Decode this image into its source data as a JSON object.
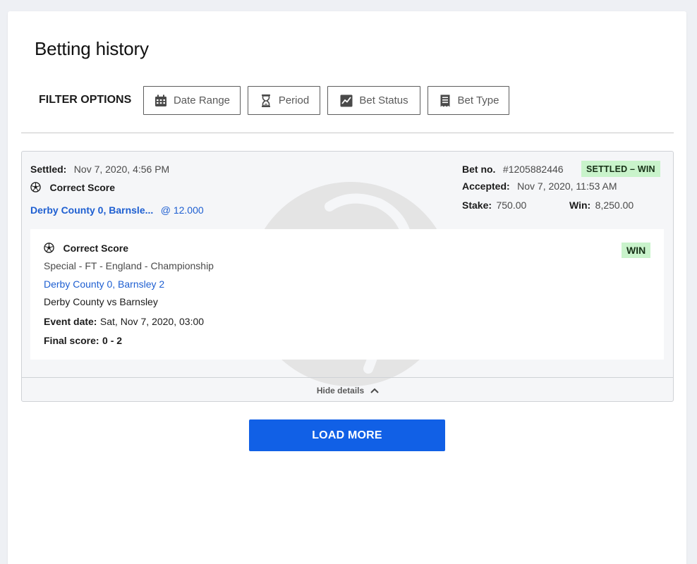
{
  "page": {
    "title": "Betting history"
  },
  "filters": {
    "label": "FILTER OPTIONS",
    "buttons": [
      {
        "label": "Date Range",
        "icon": "calendar-icon"
      },
      {
        "label": "Period",
        "icon": "hourglass-icon"
      },
      {
        "label": "Bet Status",
        "icon": "chart-line-icon"
      },
      {
        "label": "Bet Type",
        "icon": "receipt-icon"
      }
    ]
  },
  "bet": {
    "settled_label": "Settled:",
    "settled_value": "Nov 7, 2020, 4:56 PM",
    "market": "Correct Score",
    "selection_short": "Derby County 0, Barnsle...",
    "odds": "@ 12.000",
    "bet_no_label": "Bet no.",
    "bet_no_value": "#1205882446",
    "status_badge": "SETTLED – WIN",
    "accepted_label": "Accepted:",
    "accepted_value": "Nov 7, 2020, 11:53 AM",
    "stake_label": "Stake:",
    "stake_value": "750.00",
    "win_label": "Win:",
    "win_value": "8,250.00",
    "status_color": "#c9f3cb"
  },
  "details": {
    "market": "Correct Score",
    "category": "Special - FT - England - Championship",
    "selection": "Derby County 0, Barnsley 2",
    "event": "Derby County vs Barnsley",
    "event_date_label": "Event date:",
    "event_date_value": "Sat, Nov 7, 2020, 03:00",
    "final_score_label": "Final score:",
    "final_score_value": "0 - 2",
    "result_badge": "WIN",
    "toggle_label": "Hide details"
  },
  "actions": {
    "load_more": "LOAD MORE"
  },
  "colors": {
    "accent": "#1160e6",
    "link": "#1e5fd1",
    "win_bg": "#c9f3cb"
  }
}
